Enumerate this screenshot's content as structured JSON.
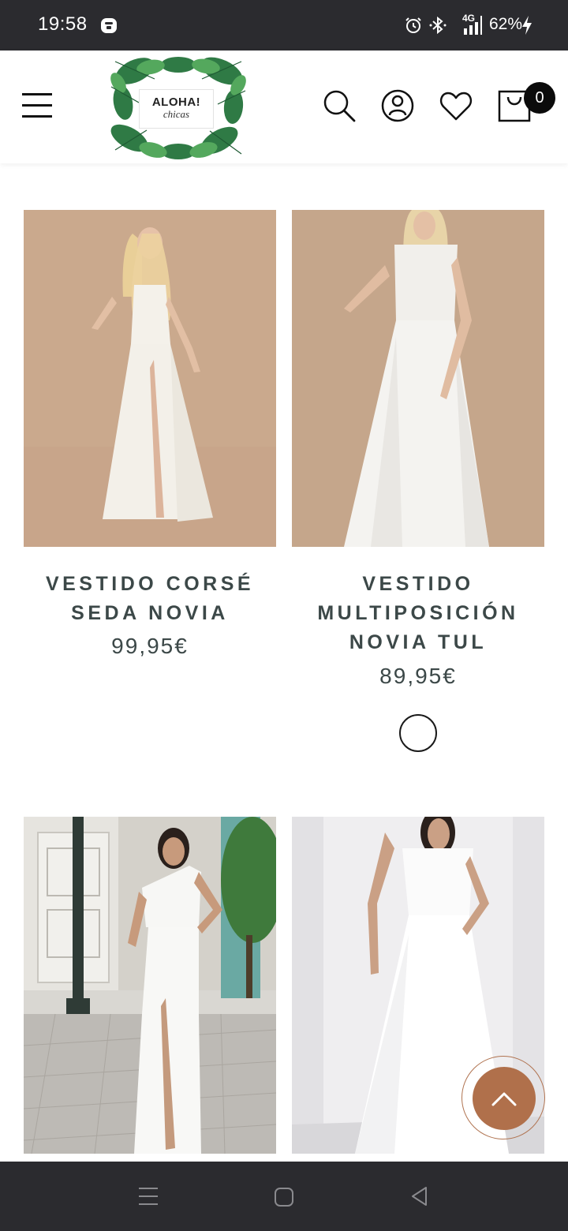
{
  "status_bar": {
    "time": "19:58",
    "network": "4G",
    "battery": "62%",
    "icons": [
      "app-notification-icon",
      "alarm-icon",
      "bluetooth-icon",
      "signal-icon",
      "charging-icon"
    ]
  },
  "header": {
    "logo": {
      "title": "ALOHA!",
      "subtitle": "chicas"
    },
    "icons": [
      "menu-icon",
      "search-icon",
      "user-icon",
      "heart-icon",
      "cart-icon"
    ],
    "cart_count": "0"
  },
  "products": [
    {
      "name": "VESTIDO CORSÉ SEDA NOVIA",
      "price": "99,95€",
      "bg": "#c9a98c"
    },
    {
      "name": "VESTIDO MULTIPOSICIÓN NOVIA TUL",
      "price": "89,95€",
      "bg": "#c4a58a",
      "swatch_color": "#ffffff"
    },
    {
      "name": "",
      "price": "",
      "bg": "#d8d6d1"
    },
    {
      "name": "",
      "price": "",
      "bg": "#ecebec"
    }
  ],
  "scroll_top": {
    "icon": "chevron-up-icon",
    "color": "#b0704b"
  },
  "nav_bar": {
    "icons": [
      "recents-icon",
      "home-icon",
      "back-icon"
    ]
  }
}
